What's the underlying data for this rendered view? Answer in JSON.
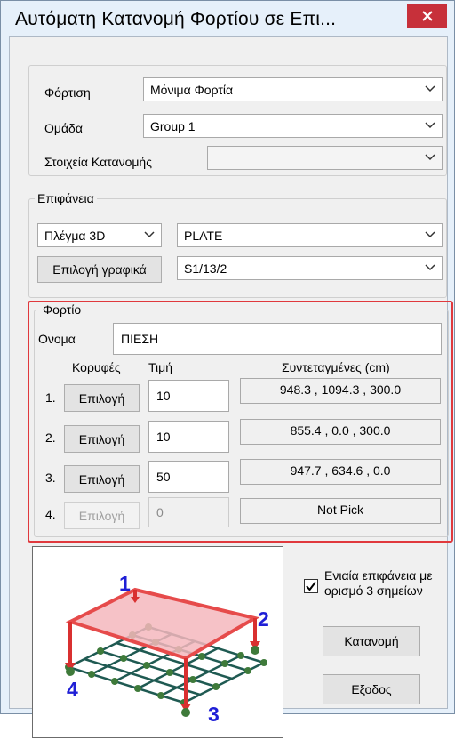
{
  "window": {
    "title": "Αυτόματη Κατανομή Φορτίου σε Επι...",
    "close_symbol": "×"
  },
  "top_group": {
    "loading_label": "Φόρτιση",
    "loading_value": "Μόνιμα Φορτία",
    "group_label": "Ομάδα",
    "group_value": "Group 1",
    "distribution_label": "Στοιχεία Κατανομής",
    "distribution_value": ""
  },
  "surface": {
    "legend": "Επιφάνεια",
    "mesh_value": "Πλέγμα 3D",
    "type_value": "PLATE",
    "graphic_select_label": "Επιλογή γραφικά",
    "element_value": "S1/13/2"
  },
  "load": {
    "legend": "Φορτίο",
    "name_label": "Ονομα",
    "name_value": "ΠΙΕΣΗ",
    "headers": {
      "vertices": "Κορυφές",
      "value": "Τιμή",
      "coords": "Συντεταγμένες (cm)"
    },
    "rows": [
      {
        "num": "1.",
        "button": "Επιλογή",
        "value": "10",
        "coords": "948.3 , 1094.3 , 300.0",
        "enabled": true
      },
      {
        "num": "2.",
        "button": "Επιλογή",
        "value": "10",
        "coords": "855.4 , 0.0 , 300.0",
        "enabled": true
      },
      {
        "num": "3.",
        "button": "Επιλογή",
        "value": "50",
        "coords": "947.7 , 634.6 , 0.0",
        "enabled": true
      },
      {
        "num": "4.",
        "button": "Επιλογή",
        "value": "0",
        "coords": "Not Pick",
        "enabled": false
      }
    ]
  },
  "preview": {
    "corner_labels": [
      "1",
      "2",
      "3",
      "4"
    ],
    "label_color": "#1f1fd6"
  },
  "options": {
    "unified_surface_label": "Ενιαία επιφάνεια με ορισμό 3 σημείων",
    "unified_surface_checked": true
  },
  "actions": {
    "distribute_label": "Κατανομή",
    "exit_label": "Εξοδος"
  },
  "colors": {
    "highlight_frame": "#e0393d",
    "close_button": "#c7303a"
  }
}
